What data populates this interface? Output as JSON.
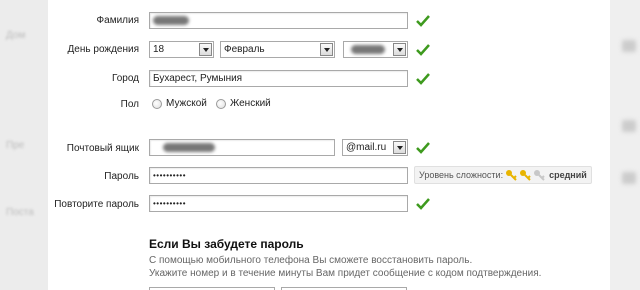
{
  "labels": {
    "surname": "Фамилия",
    "birthday": "День рождения",
    "city": "Город",
    "gender": "Пол",
    "mailbox": "Почтовый ящик",
    "password": "Пароль",
    "repeat_password": "Повторите пароль"
  },
  "birthday": {
    "day": "18",
    "month": "Февраль"
  },
  "city_value": "Бухарест, Румыния",
  "gender_options": {
    "male": "Мужской",
    "female": "Женский"
  },
  "domain_value": "@mail.ru",
  "password_value": "••••••••••",
  "repeat_password_value": "••••••••••",
  "strength": {
    "label": "Уровень сложности:",
    "value": "средний",
    "level_keys": 2,
    "total_keys": 3
  },
  "recovery": {
    "title": "Если Вы забудете пароль",
    "line1": "С помощью мобильного телефона Вы сможете восстановить пароль.",
    "line2": "Укажите номер и в течение минуты Вам придет сообщение с кодом подтверждения."
  },
  "colors": {
    "check": "#3e9a1e",
    "key_active": "#e8b400",
    "key_inactive": "#c8c8c8"
  }
}
